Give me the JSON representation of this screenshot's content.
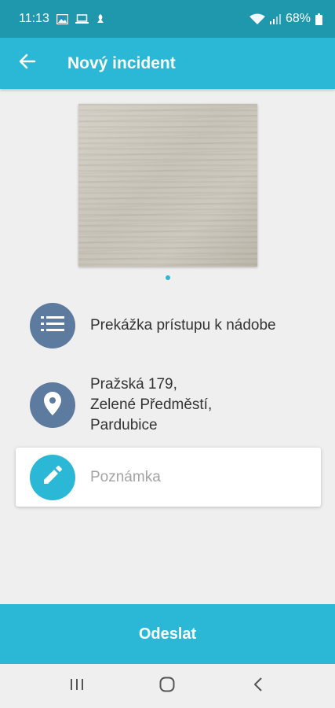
{
  "status_bar": {
    "time": "11:13",
    "battery": "68%"
  },
  "app_bar": {
    "title": "Nový incident"
  },
  "incident": {
    "category": "Prekážka prístupu k nádobe",
    "address_lines": [
      "Pražská 179,",
      "Zelené Předměstí,",
      "Pardubice"
    ]
  },
  "note": {
    "placeholder": "Poznámka"
  },
  "submit": {
    "label": "Odeslat"
  },
  "colors": {
    "status_bar": "#1f97ad",
    "accent": "#2bb8d6",
    "muted_icon_bg": "#5d7b9f",
    "background": "#efefef"
  },
  "icons": {
    "back": "arrow-left-icon",
    "category": "list-icon",
    "location": "location-pin-icon",
    "note": "pencil-icon",
    "nav_recents": "recents-icon",
    "nav_home": "home-icon",
    "nav_back": "back-chevron-icon"
  }
}
